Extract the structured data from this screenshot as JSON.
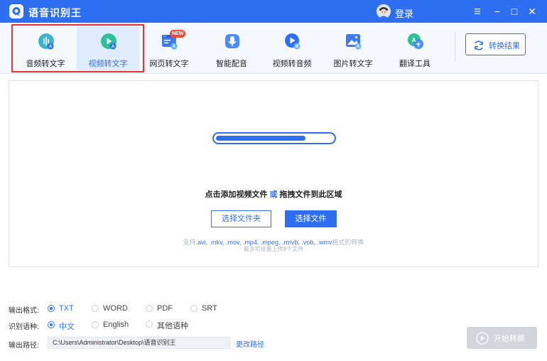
{
  "titlebar": {
    "app_title": "语音识别王",
    "login_label": "登录",
    "minimize_symbol": "−",
    "maximize_symbol": "□",
    "close_symbol": "✕"
  },
  "toolbar": {
    "tools": [
      {
        "label": "音频转文字",
        "icon": "audio-to-text-icon",
        "active": false
      },
      {
        "label": "视频转文字",
        "icon": "video-to-text-icon",
        "active": true
      },
      {
        "label": "网页转文字",
        "icon": "webpage-to-text-icon",
        "active": false,
        "badge": "NEW"
      },
      {
        "label": "智能配音",
        "icon": "smart-dubbing-icon",
        "active": false
      },
      {
        "label": "视频转音频",
        "icon": "video-to-audio-icon",
        "active": false
      },
      {
        "label": "图片转文字",
        "icon": "image-to-text-icon",
        "active": false
      },
      {
        "label": "翻译工具",
        "icon": "translate-icon",
        "active": false
      }
    ],
    "result_button": "转换结果"
  },
  "dropzone": {
    "progress": 0.77,
    "hint_left": "点击添加视频文件",
    "hint_or": "或",
    "hint_right": "拖拽文件到此区域",
    "select_folder_button": "选择文件夹",
    "select_file_button": "选择文件",
    "formats_prefix": "支持",
    "formats_list": ".avi, .mkv, .mov, .mp4, .mpeg, .rmvb, .vob, .wmv",
    "formats_suffix": "格式的转换",
    "limit_text": "最多可批量上传8个文件"
  },
  "options": {
    "output_format_label": "输出格式:",
    "output_formats": [
      {
        "label": "TXT",
        "checked": true
      },
      {
        "label": "WORD",
        "checked": false
      },
      {
        "label": "PDF",
        "checked": false
      },
      {
        "label": "SRT",
        "checked": false
      }
    ],
    "language_label": "识别语种:",
    "languages": [
      {
        "label": "中文",
        "checked": true
      },
      {
        "label": "English",
        "checked": false
      },
      {
        "label": "其他语种",
        "checked": false
      }
    ],
    "output_path_label": "输出路径:",
    "output_path": "C:\\Users\\Administrator\\Desktop\\语音识别王",
    "change_path": "更改路径"
  },
  "start_button": "开始转换",
  "colors": {
    "accent": "#2e6ff2",
    "highlight_border": "#e03333",
    "disabled_button": "#d2d6dc"
  }
}
